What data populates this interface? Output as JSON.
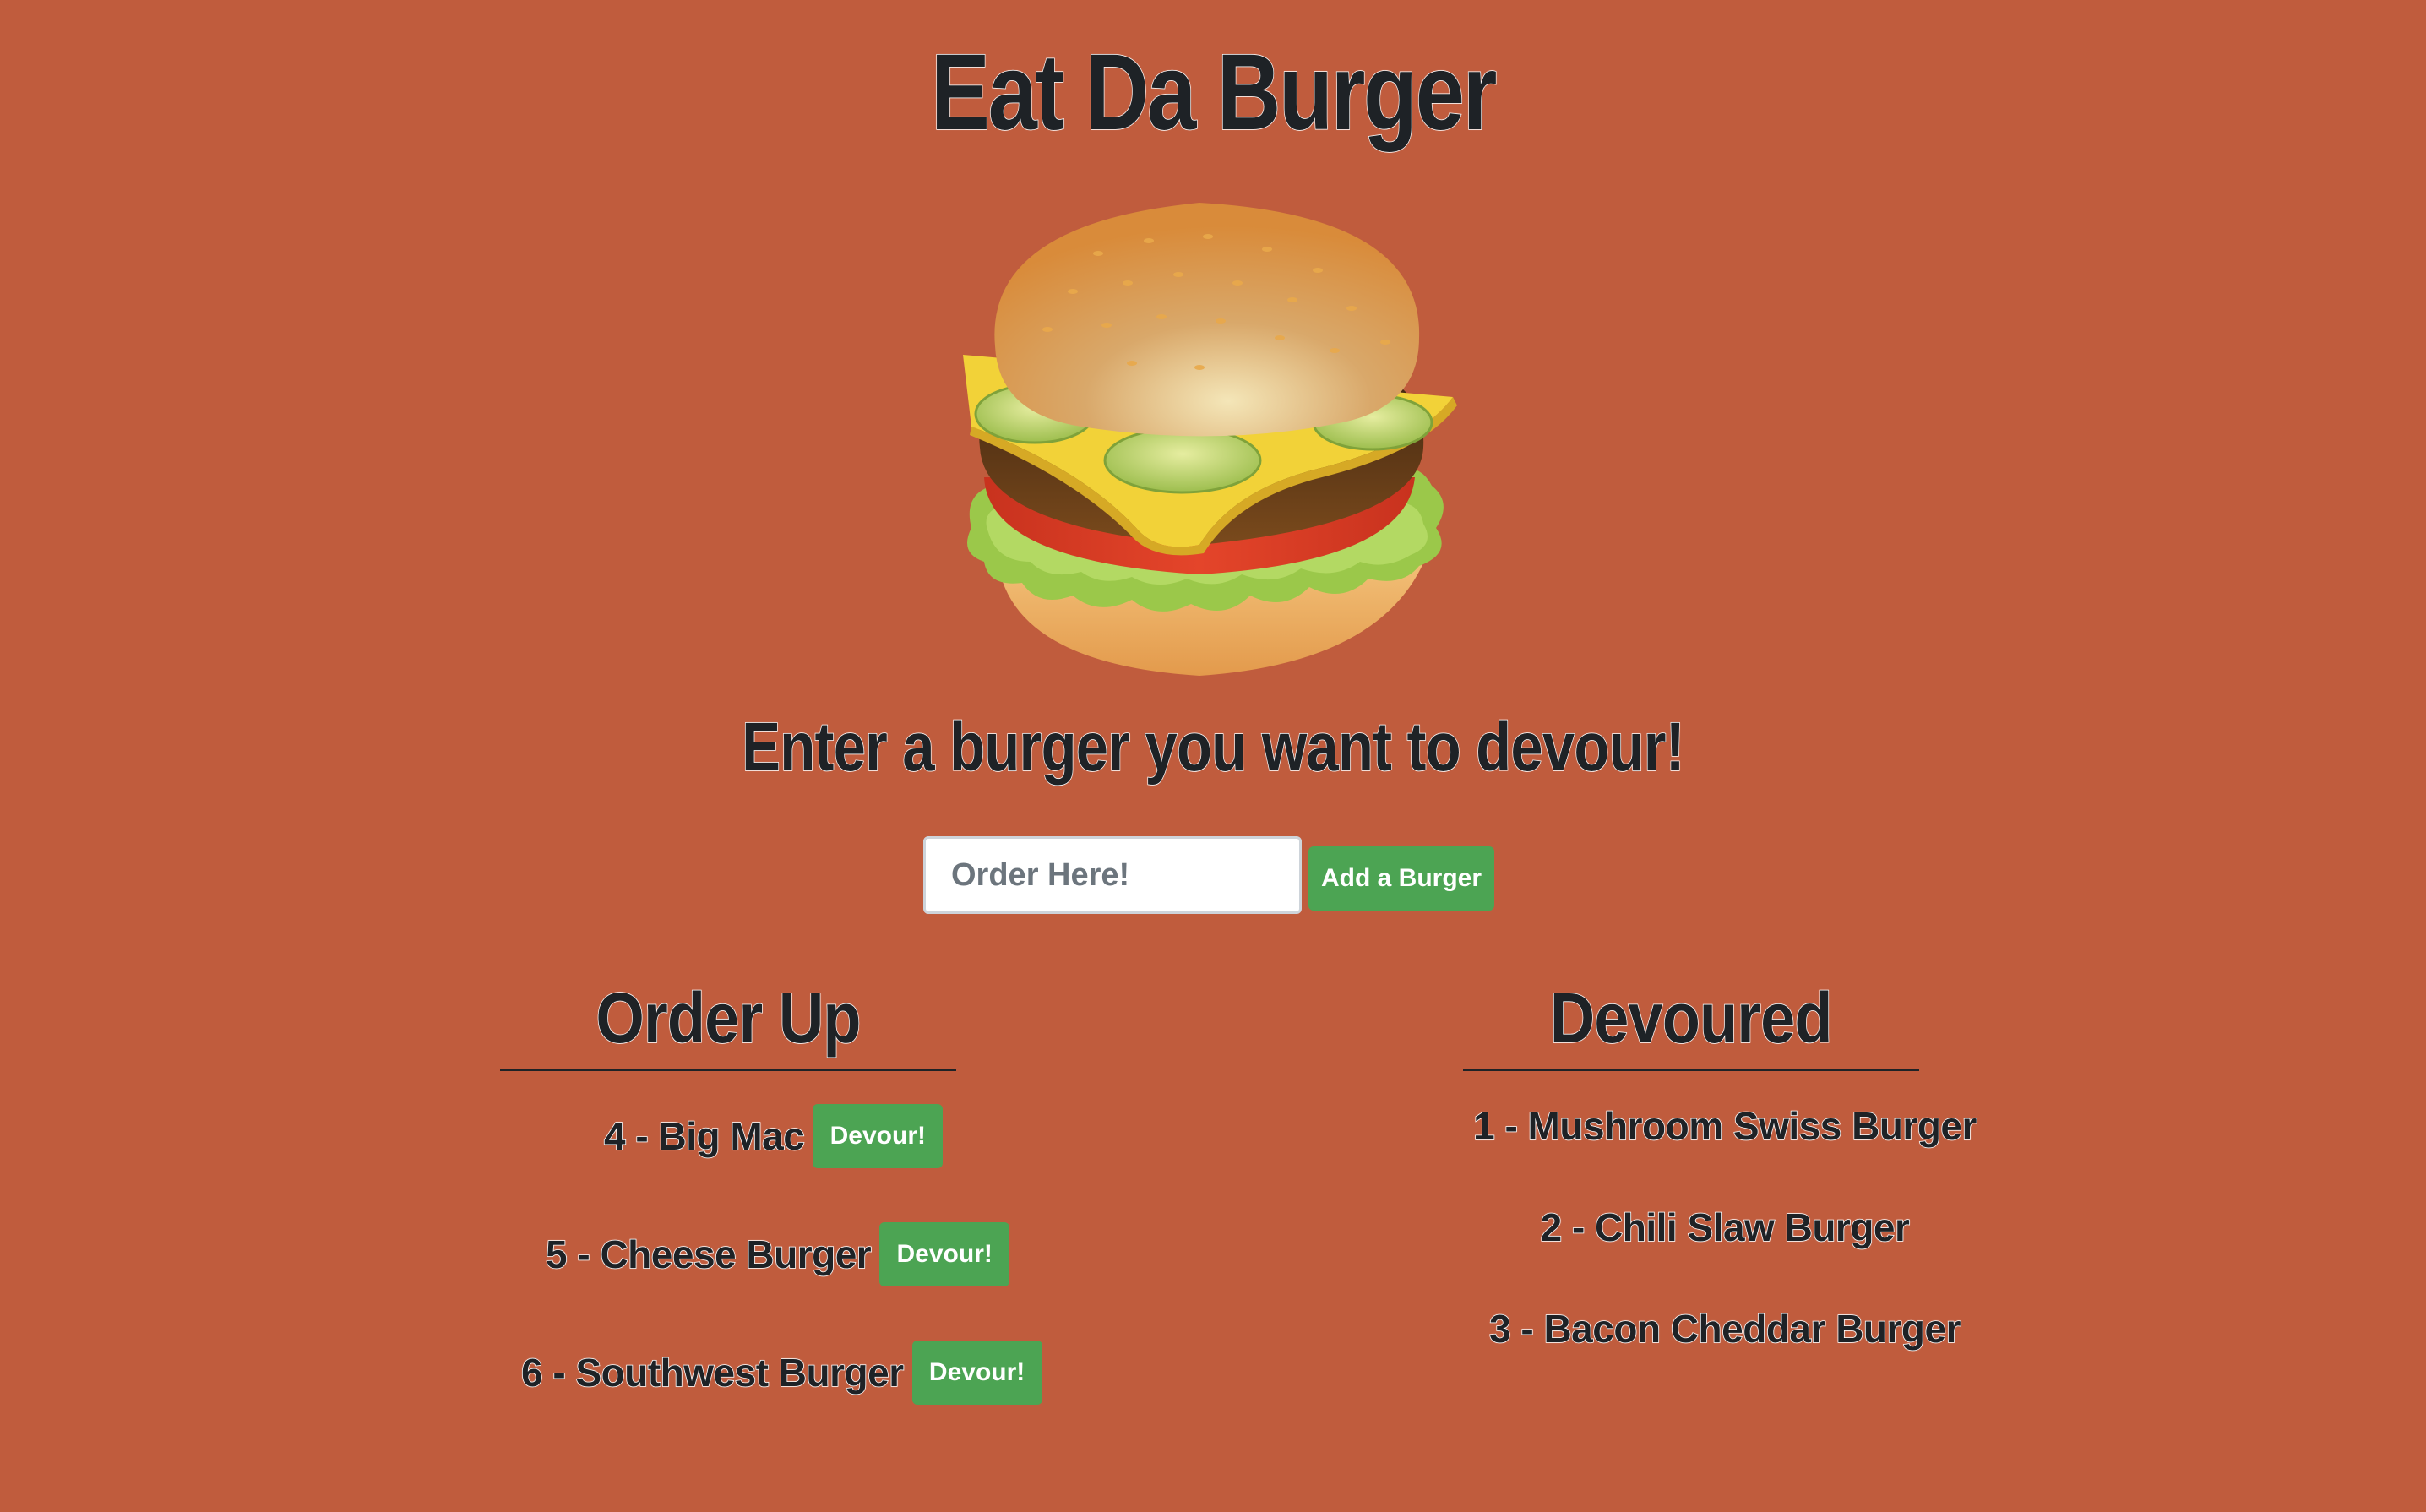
{
  "header": {
    "title": "Eat Da Burger"
  },
  "hero": {
    "image_icon": "burger-illustration"
  },
  "form": {
    "prompt": "Enter a burger you want to devour!",
    "input_placeholder": "Order Here!",
    "input_value": "",
    "submit_label": "Add a Burger"
  },
  "order_up": {
    "heading": "Order Up",
    "items": [
      {
        "label": "4 - Big Mac",
        "button": "Devour!"
      },
      {
        "label": "5 - Cheese Burger",
        "button": "Devour!"
      },
      {
        "label": "6 - Southwest Burger",
        "button": "Devour!"
      }
    ]
  },
  "devoured": {
    "heading": "Devoured",
    "items": [
      {
        "label": "1 - Mushroom Swiss Burger"
      },
      {
        "label": "2 - Chili Slaw Burger"
      },
      {
        "label": "3 - Bacon Cheddar Burger"
      }
    ]
  },
  "colors": {
    "background": "#C05C3D",
    "button": "#4CA453",
    "text": "#1E2226"
  }
}
